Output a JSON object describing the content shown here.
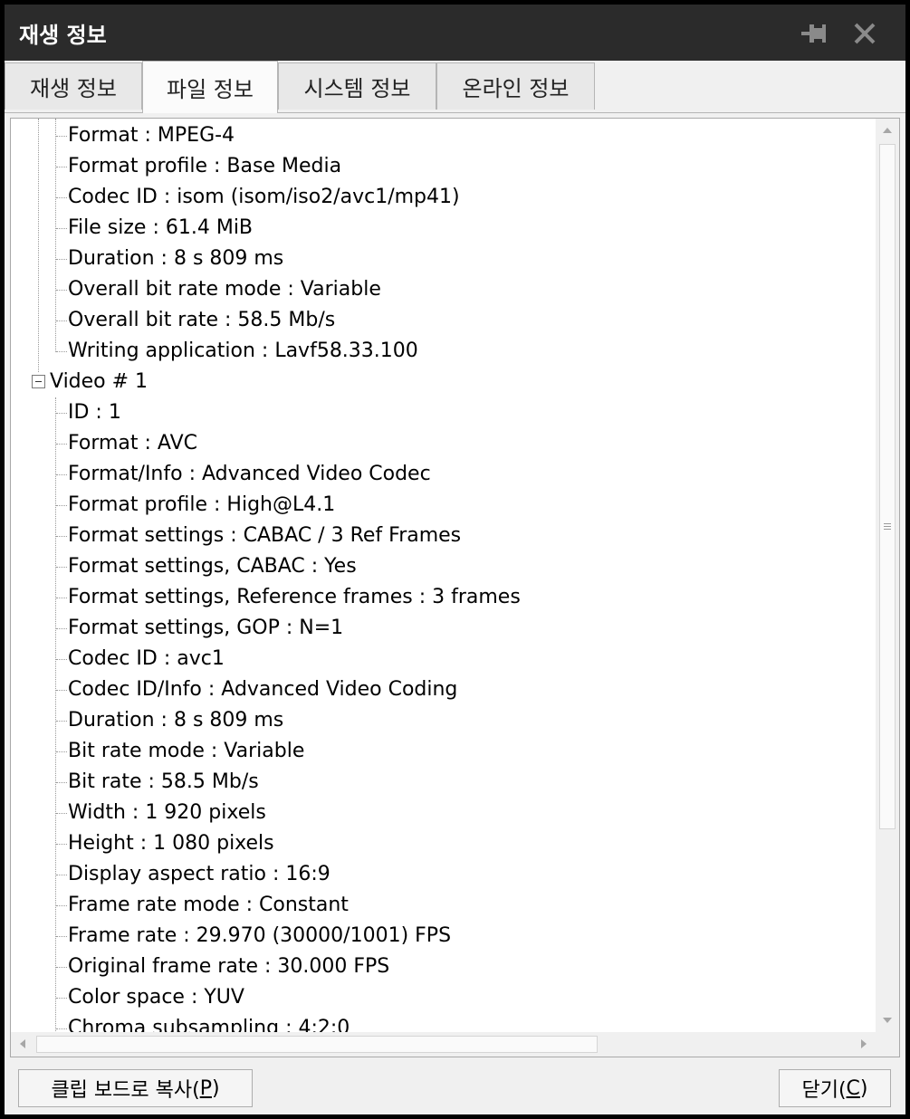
{
  "window": {
    "title": "재생 정보"
  },
  "icons": {
    "pin": "pin-icon",
    "close": "close-icon",
    "collapse": "minus-icon"
  },
  "tabs": [
    {
      "label": "재생 정보",
      "active": false
    },
    {
      "label": "파일 정보",
      "active": true
    },
    {
      "label": "시스템 정보",
      "active": false
    },
    {
      "label": "온라인 정보",
      "active": false
    }
  ],
  "tree": {
    "general_items": [
      "Format : MPEG-4",
      "Format profile : Base Media",
      "Codec ID : isom (isom/iso2/avc1/mp41)",
      "File size : 61.4 MiB",
      "Duration : 8 s 809 ms",
      "Overall bit rate mode : Variable",
      "Overall bit rate : 58.5 Mb/s",
      "Writing application : Lavf58.33.100"
    ],
    "video_node": "Video # 1",
    "video_items": [
      "ID : 1",
      "Format : AVC",
      "Format/Info : Advanced Video Codec",
      "Format profile : High@L4.1",
      "Format settings : CABAC / 3 Ref Frames",
      "Format settings, CABAC : Yes",
      "Format settings, Reference frames : 3 frames",
      "Format settings, GOP : N=1",
      "Codec ID : avc1",
      "Codec ID/Info : Advanced Video Coding",
      "Duration : 8 s 809 ms",
      "Bit rate mode : Variable",
      "Bit rate : 58.5 Mb/s",
      "Width : 1 920 pixels",
      "Height : 1 080 pixels",
      "Display aspect ratio : 16:9",
      "Frame rate mode : Constant",
      "Frame rate : 29.970 (30000/1001) FPS",
      "Original frame rate : 30.000 FPS",
      "Color space : YUV",
      "Chroma subsampling : 4:2:0"
    ]
  },
  "buttons": {
    "copy_label": "클립 보드로 복사(",
    "copy_key": "P",
    "copy_suffix": ")",
    "close_label": "닫기(",
    "close_key": "C",
    "close_suffix": ")"
  }
}
